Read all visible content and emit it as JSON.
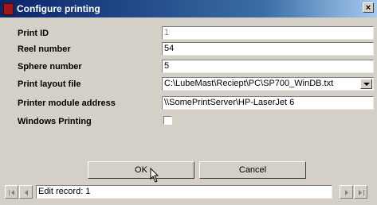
{
  "window": {
    "title": "Configure printing",
    "close_label": "×"
  },
  "form": {
    "print_id": {
      "label": "Print ID",
      "value": "1"
    },
    "reel_number": {
      "label": "Reel number",
      "value": "54"
    },
    "sphere_number": {
      "label": "Sphere number",
      "value": "5"
    },
    "print_layout_file": {
      "label": "Print layout file",
      "value": "C:\\LubeMast\\Reciept\\PC\\SP700_WinDB.txt"
    },
    "printer_module_address": {
      "label": "Printer module address",
      "value": "\\\\SomePrintServer\\HP-LaserJet 6"
    },
    "windows_printing": {
      "label": "Windows Printing",
      "checked": false
    }
  },
  "buttons": {
    "ok_label": "OK",
    "cancel_label": "Cancel"
  },
  "navigator": {
    "record_text": "Edit record: 1"
  },
  "icons": {
    "app": "app-icon",
    "close": "close-icon",
    "dropdown": "chevron-down-icon",
    "first": "first-record-icon",
    "prev": "prev-record-icon",
    "next": "next-record-icon",
    "last": "last-record-icon",
    "cursor": "mouse-cursor-icon"
  },
  "colors": {
    "titlebar_start": "#0a246a",
    "titlebar_end": "#a6caf0",
    "face": "#d4d0c8",
    "app_icon": "#a01818"
  }
}
